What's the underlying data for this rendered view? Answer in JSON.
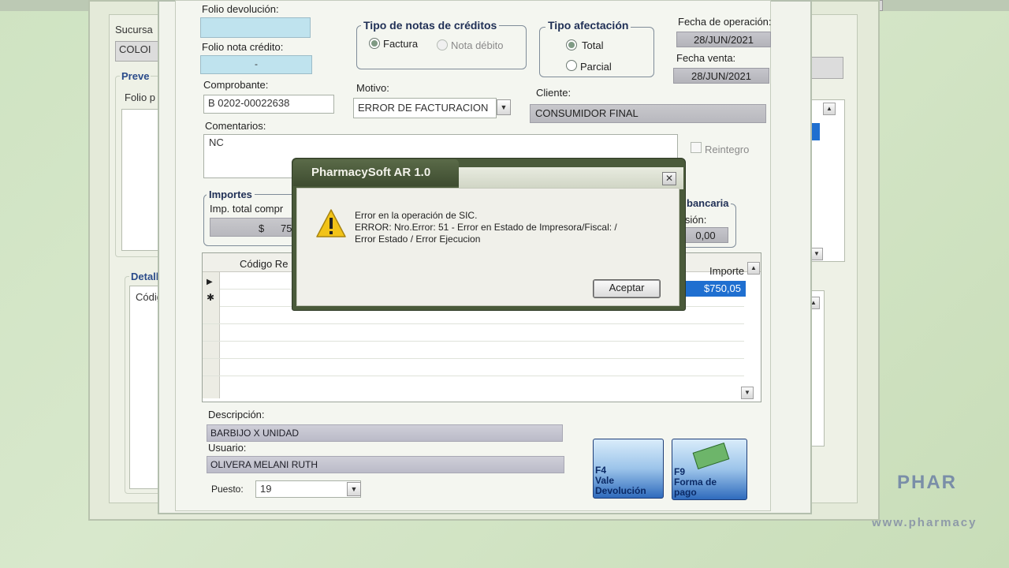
{
  "background_window": {
    "sucursal_label": "Sucursa",
    "sucursal_value": "COLOI",
    "preventa_group": "Preve",
    "folio_label": "Folio p",
    "detalle_group": "Detall",
    "codigo_label": "Códig"
  },
  "brand": {
    "logo_text": "PHAR",
    "url_text": "www.pharmacy"
  },
  "form": {
    "folio_devolucion_label": "Folio devolución:",
    "folio_devolucion_value": "",
    "folio_nota_credito_label": "Folio nota crédito:",
    "folio_nota_credito_value": "-",
    "tipo_notas": {
      "title": "Tipo de notas de créditos",
      "options": [
        {
          "label": "Factura",
          "checked": true,
          "enabled": true
        },
        {
          "label": "Nota débito",
          "checked": false,
          "enabled": false
        }
      ]
    },
    "tipo_afectacion": {
      "title": "Tipo afectación",
      "options": [
        {
          "label": "Total",
          "checked": true
        },
        {
          "label": "Parcial",
          "checked": false
        }
      ]
    },
    "fecha_operacion_label": "Fecha de operación:",
    "fecha_operacion_value": "28/JUN/2021",
    "fecha_venta_label": "Fecha venta:",
    "fecha_venta_value": "28/JUN/2021",
    "comprobante_label": "Comprobante:",
    "comprobante_value": "B 0202-00022638",
    "motivo_label": "Motivo:",
    "motivo_value": "ERROR DE FACTURACION",
    "cliente_label": "Cliente:",
    "cliente_value": "CONSUMIDOR FINAL",
    "comentarios_label": "Comentarios:",
    "comentarios_value": "NC",
    "reintegro_label": "Reintegro",
    "importes": {
      "title": "Importes",
      "total_label": "Imp. total compr",
      "total_currency": "$",
      "total_value": "75"
    },
    "bancaria": {
      "title": "bancaria",
      "label": "isión:",
      "value": "0,00"
    },
    "grid": {
      "col_codigo": "Código Re",
      "col_importe": "Importe",
      "row_marker_current": "▶",
      "row_marker_new": "✱",
      "importe_value": "$750,05"
    },
    "descripcion_label": "Descripción:",
    "descripcion_value": "BARBIJO X UNIDAD",
    "usuario_label": "Usuario:",
    "usuario_value": "OLIVERA MELANI RUTH",
    "puesto_label": "Puesto:",
    "puesto_value": "19",
    "buttons": {
      "f4_key": "F4",
      "f4_label_1": "Vale",
      "f4_label_2": "Devolución",
      "f9_key": "F9",
      "f9_label_1": "Forma de",
      "f9_label_2": "pago"
    }
  },
  "dialog": {
    "title": "PharmacySoft AR 1.0",
    "icon": "warning-icon",
    "message_lines": [
      "Error en la operación de SIC.",
      "ERROR: Nro.Error: 51 - Error en Estado de Impresora/Fiscal: /",
      "Error Estado / Error Ejecucion"
    ],
    "ok_label": "Aceptar"
  },
  "colors": {
    "selected_cell": "#1f6fd0",
    "group_title": "#1f2f55",
    "dialog_frame": "#4a5a3a",
    "warning_yellow": "#f2c318"
  }
}
